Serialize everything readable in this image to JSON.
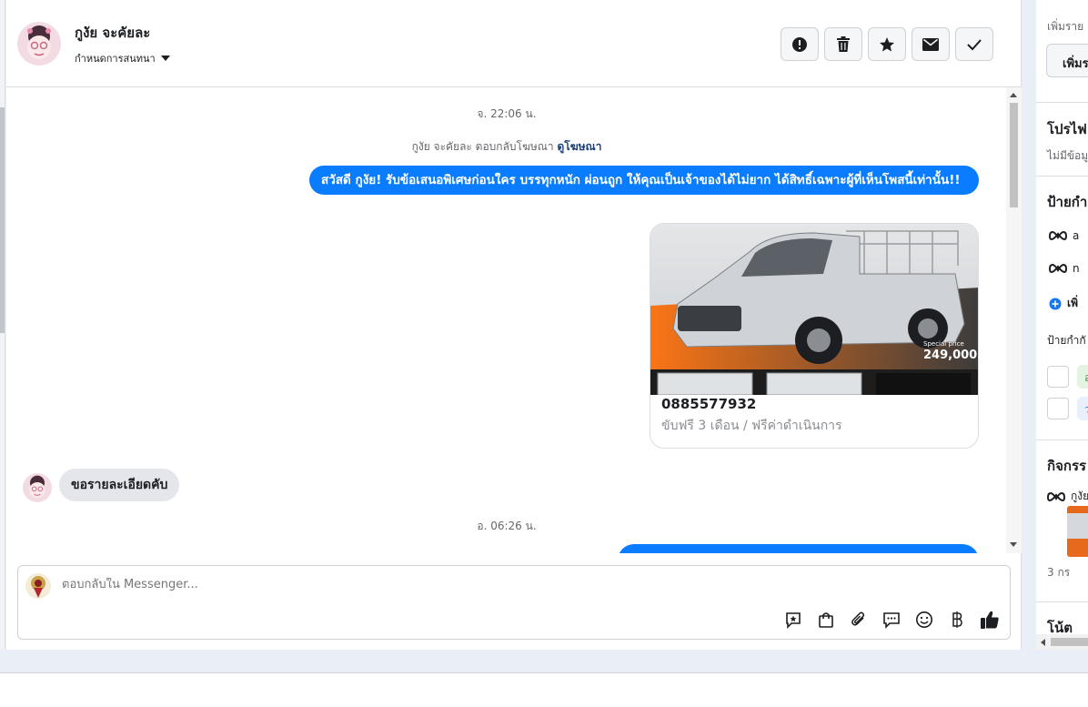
{
  "contact": {
    "name": "กูงัย จะคัยละ",
    "settings_label": "กำหนดการสนทนา"
  },
  "header_actions": [
    {
      "name": "report-icon"
    },
    {
      "name": "trash-icon"
    },
    {
      "name": "star-icon"
    },
    {
      "name": "mail-icon"
    },
    {
      "name": "check-icon"
    }
  ],
  "thread": {
    "timestamp_1": "จ. 22:06 น.",
    "ad_reply_text": "กูงัย จะคัยละ ตอบกลับโฆษณา",
    "ad_reply_link": "ดูโฆษณา",
    "outgoing_message": "สวัสดี กูงัย! รับข้อเสนอพิเศษก่อนใคร บรรทุกหนัก ผ่อนถูก ให้คุณเป็นเจ้าของได้ไม่ยาก ได้สิทธิ์เฉพาะผู้ที่เห็นโพสนี้เท่านั้น!!",
    "ad_card": {
      "price_tag": "249,000.",
      "special_label": "Special price",
      "title": "0885577932",
      "subtitle": "ขับฟรี 3 เดือน / ฟรีค่าดำเนินการ"
    },
    "incoming_message": "ขอรายละเอียดคับ",
    "timestamp_2": "อ. 06:26 น."
  },
  "composer": {
    "placeholder": "ตอบกลับใน Messenger...",
    "tools": [
      "saved-reply-icon",
      "shop-bag-icon",
      "attach-icon",
      "quick-reply-icon",
      "emoji-icon",
      "baht-icon",
      "like-icon"
    ]
  },
  "side": {
    "add_details_hint": "เพิ่มราย",
    "add_button": "เพิ่มร",
    "profile_title": "โปรไฟ",
    "no_data": "ไม่มีข้อมูล",
    "labels_title": "ป้ายกำ",
    "meta_row_1": "a",
    "meta_row_2": "n",
    "add_label": "เพิ่",
    "labels_sub": "ป้ายกำกั",
    "pill_1": "อ",
    "pill_2": "ว",
    "activity_title": "กิจกรร",
    "activity_name": "กูงัย",
    "activity_date": "3 กร",
    "notes_title": "โน้ต"
  },
  "colors": {
    "messenger_blue": "#0a7cff",
    "border": "#dadde1",
    "muted_text": "#65676b"
  }
}
